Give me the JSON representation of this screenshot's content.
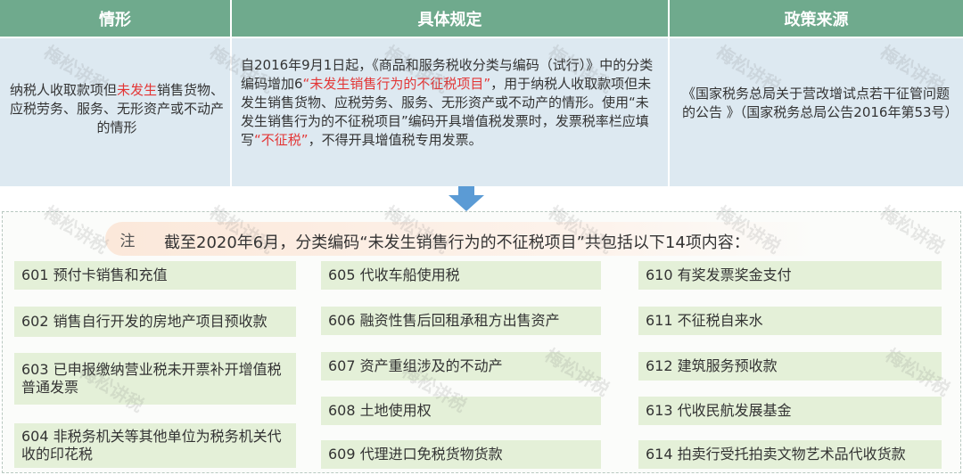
{
  "table": {
    "headers": [
      "情形",
      "具体规定",
      "政策来源"
    ],
    "situation": {
      "before": "纳税人收取款项但",
      "highlight": "未发生",
      "after": "销售货物、应税劳务、服务、无形资产或不动产的情形"
    },
    "provision": {
      "part1": "自2016年9月1日起，《商品和服务税收分类与编码（试行）》中的分类编码增加6",
      "quote1": "“未发生销售行为的不征税项目”",
      "part2": "，用于纳税人收取款项但未发生销售货物、应税劳务、服务、无形资产或不动产的情形。使用“未发生销售行为的不征税项目”编码开具增值税发票时，发票税率栏应填写",
      "quote2": "“不征税”",
      "part3": "，不得开具增值税专用发票。"
    },
    "source": "《国家税务总局关于营改增试点若干征管问题的公告 》（国家税务总局公告2016年第53号）"
  },
  "note": {
    "badge": "注",
    "text": "截至2020年6月，分类编码“未发生销售行为的不征税项目”共包括以下14项内容："
  },
  "items": [
    "601 预付卡销售和充值",
    "602 销售自行开发的房地产项目预收款",
    "603 已申报缴纳营业税未开票补开增值税普通发票",
    "604 非税务机关等其他单位为税务机关代收的印花税",
    "605 代收车船使用税",
    "606 融资性售后回租承租方出售资产",
    "607 资产重组涉及的不动产",
    "608 土地使用权",
    "609 代理进口免税货物货款",
    "610 有奖发票奖金支付",
    "611 不征税自来水",
    "612 建筑服务预收款",
    "613 代收民航发展基金",
    "614 拍卖行受托拍卖文物艺术品代收货款"
  ],
  "watermark": "梅松讲税",
  "colors": {
    "header": "#6faa8d",
    "row": "#dde9f1",
    "item": "#e4f0d8",
    "highlight": "#e33636",
    "arrow": "#5b9bd5",
    "note_bg": "#fbe8da"
  }
}
